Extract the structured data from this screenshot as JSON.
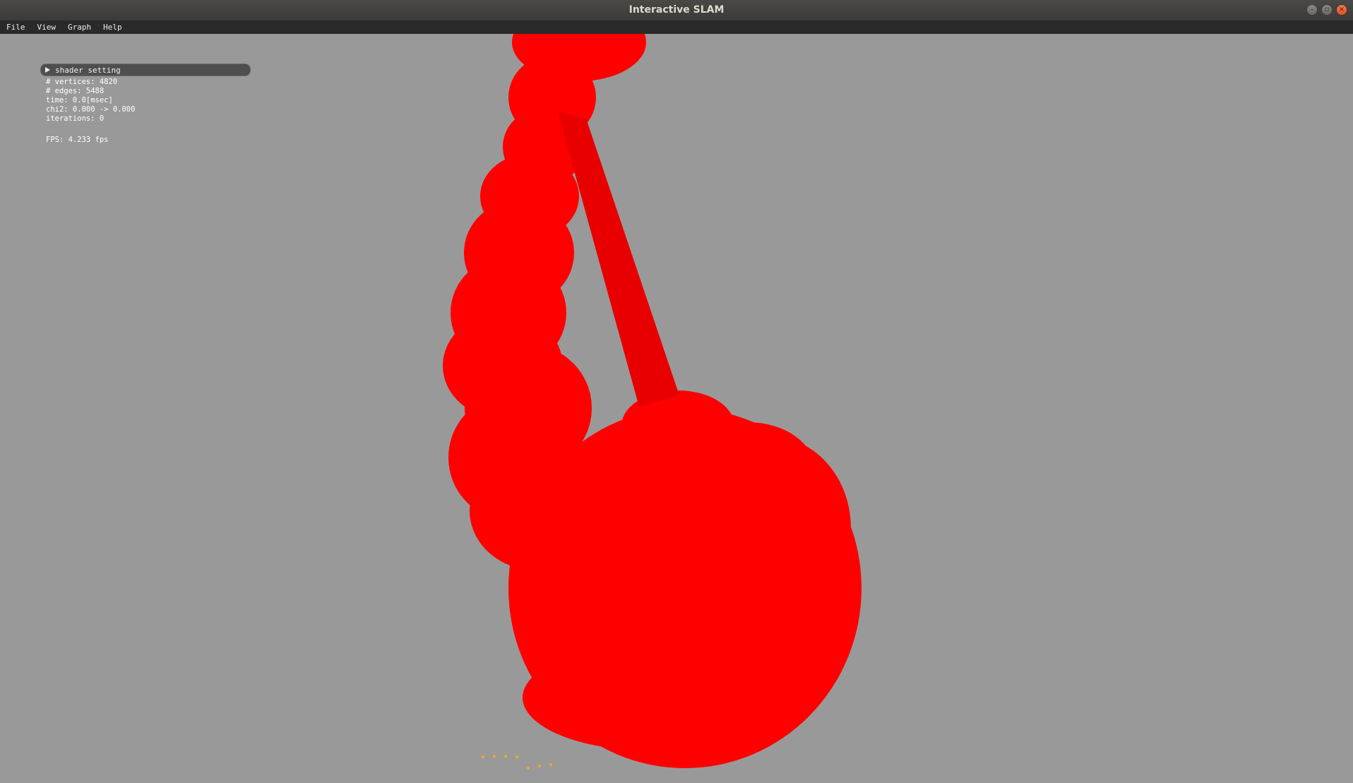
{
  "window": {
    "title": "Interactive SLAM",
    "minimize_glyph": "–",
    "maximize_glyph": "▫",
    "close_glyph": "×"
  },
  "menu": {
    "items": [
      "File",
      "View",
      "Graph",
      "Help"
    ]
  },
  "panel": {
    "header_label": "shader setting",
    "vertices": "# vertices: 4820",
    "edges": "# edges: 5488",
    "time": "time: 0.0[msec]",
    "chi2": "chi2: 0.000 -> 0.000",
    "iterations": "iterations: 0",
    "fps": "FPS: 4.233 fps"
  },
  "colors": {
    "viewport_bg": "#999999",
    "trajectory": "#ff0000",
    "edge_line": "#e80000",
    "marker": "#f5a623"
  },
  "icons": [
    "collapse-arrow-icon",
    "minimize-icon",
    "maximize-icon",
    "close-icon"
  ]
}
